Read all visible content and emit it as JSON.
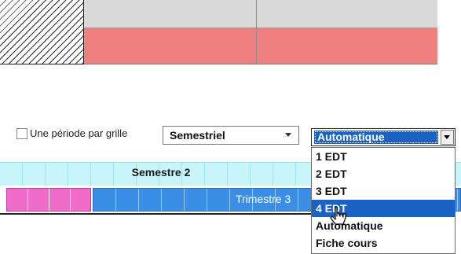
{
  "checkbox": {
    "label": "Une période par grille",
    "checked": false
  },
  "period_select": {
    "value": "Semestriel"
  },
  "layout_select": {
    "value": "Automatique",
    "options": [
      "1 EDT",
      "2 EDT",
      "3 EDT",
      "4 EDT",
      "Automatique",
      "Fiche cours"
    ],
    "highlighted": "4 EDT"
  },
  "timeline": {
    "semester_label": "Semestre 2",
    "trimester_label": "Trimestre 3"
  },
  "colors": {
    "accent": "#1a63c4",
    "red_row": "#f08080",
    "semester_bar": "#c8f5fa",
    "pink_period": "#f06cc8",
    "blue_period": "#3a8ee6"
  }
}
